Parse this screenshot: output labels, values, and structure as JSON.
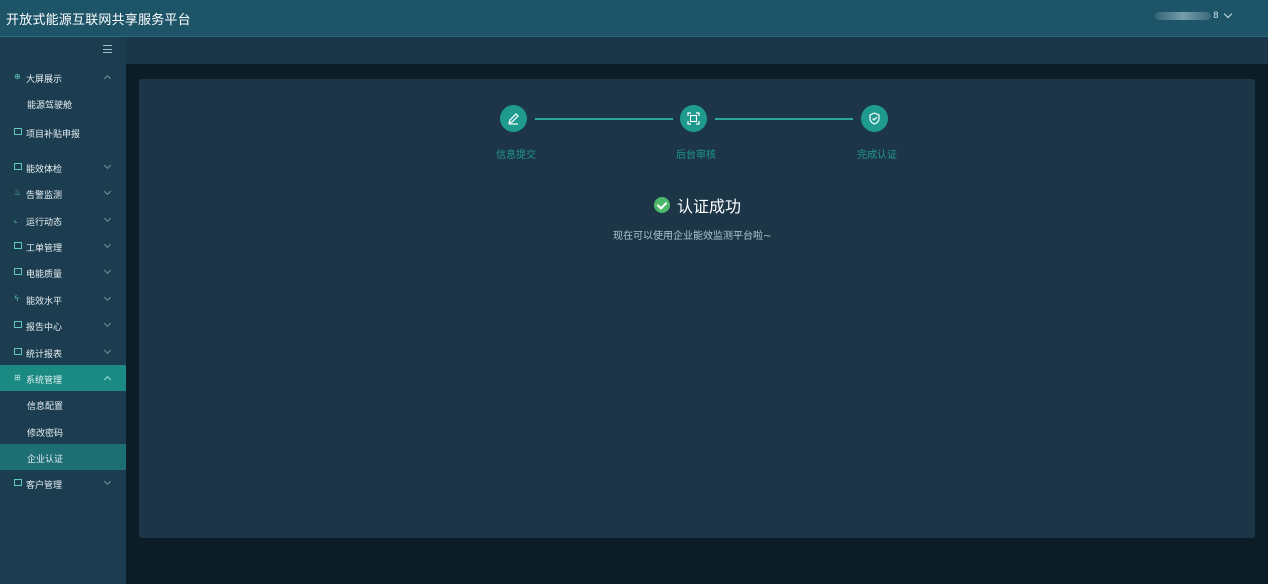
{
  "header": {
    "title": "开放式能源互联网共享服务平台",
    "user_suffix": "8"
  },
  "sidebar": {
    "items": [
      {
        "label": "大屏展示",
        "icon": "globe-icon",
        "expanded": true
      },
      {
        "label": "能源驾驶舱",
        "sub": true
      },
      {
        "label": "项目补贴申报",
        "icon": "list-icon"
      },
      {
        "label": "能效体检",
        "icon": "grid-icon"
      },
      {
        "label": "告警监测",
        "icon": "alarm-icon"
      },
      {
        "label": "运行动态",
        "icon": "chart-icon"
      },
      {
        "label": "工单管理",
        "icon": "table-icon"
      },
      {
        "label": "电能质量",
        "icon": "monitor-icon"
      },
      {
        "label": "能效水平",
        "icon": "bolt-icon"
      },
      {
        "label": "报告中心",
        "icon": "report-icon"
      },
      {
        "label": "统计报表",
        "icon": "stats-icon"
      },
      {
        "label": "系统管理",
        "icon": "settings-grid-icon",
        "active": true
      },
      {
        "label": "信息配置",
        "sub": true
      },
      {
        "label": "修改密码",
        "sub": true
      },
      {
        "label": "企业认证",
        "sub": true,
        "selected": true
      },
      {
        "label": "客户管理",
        "icon": "building-icon"
      }
    ]
  },
  "steps": [
    {
      "label": "信息提交",
      "icon": "edit-icon"
    },
    {
      "label": "后台审核",
      "icon": "scan-icon"
    },
    {
      "label": "完成认证",
      "icon": "shield-check-icon"
    }
  ],
  "result": {
    "title": "认证成功",
    "subtitle": "现在可以使用企业能效监测平台啦~"
  },
  "colors": {
    "header_bg": "#1d5468",
    "sidebar_bg": "#1c3d4f",
    "accent": "#1e9a8e",
    "active_menu": "#1a8a82",
    "success": "#4cb86a"
  }
}
